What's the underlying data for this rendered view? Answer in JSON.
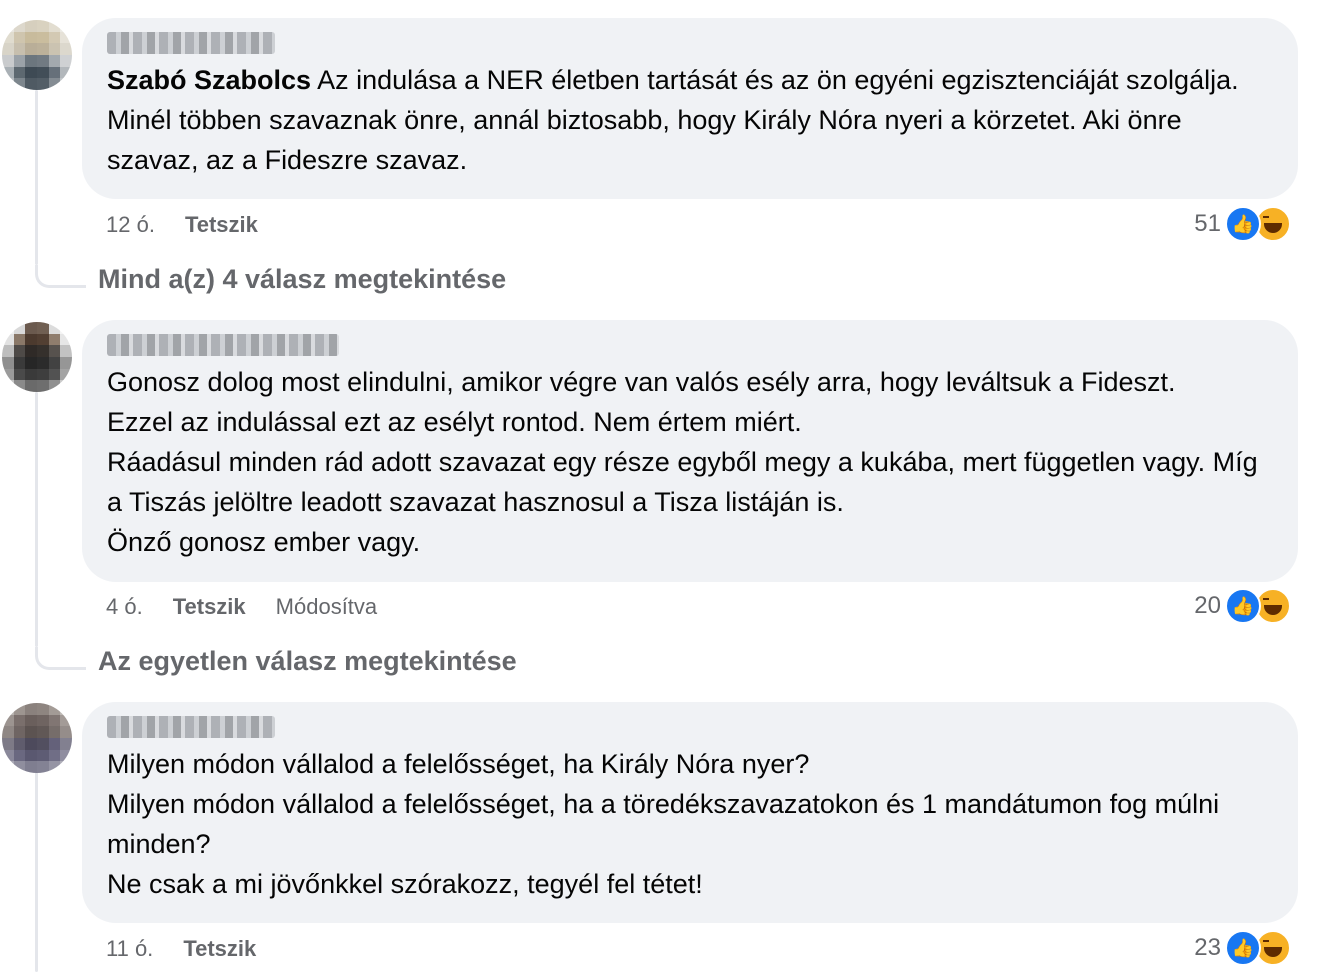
{
  "comments": [
    {
      "mention": "Szabó Szabolcs",
      "text": " Az indulása a NER életben tartását és az ön egyéni egzisztenciáját szolgálja. Minél többen szavaznak önre, annál biztosabb, hogy Király Nóra nyeri a körzetet. Aki önre szavaz, az a Fideszre szavaz.",
      "time": "12 ó.",
      "like_label": "Tetszik",
      "edited": "",
      "reaction_count": "51",
      "replies_link": "Mind a(z) 4 válasz megtekintése"
    },
    {
      "mention": "",
      "text": "Gonosz dolog most elindulni, amikor végre van valós esély arra, hogy leváltsuk a Fideszt.\nEzzel az indulással ezt az esélyt rontod. Nem értem miért.\nRáadásul minden rád adott szavazat egy része egyből megy a kukába, mert független vagy. Míg a Tiszás jelöltre leadott szavazat hasznosul a Tisza listáján is.\nÖnző gonosz ember vagy.",
      "time": "4 ó.",
      "like_label": "Tetszik",
      "edited": "Módosítva",
      "reaction_count": "20",
      "replies_link": "Az egyetlen válasz megtekintése"
    },
    {
      "mention": "",
      "text": "Milyen módon vállalod a felelősséget, ha Király Nóra nyer?\nMilyen módon vállalod a felelősséget, ha a töredékszavazatokon és 1 mandátumon fog múlni minden?\nNe csak a mi jövőnkkel szórakozz, tegyél fel tétet!",
      "time": "11 ó.",
      "like_label": "Tetszik",
      "edited": "",
      "reaction_count": "23",
      "replies_link": ""
    }
  ],
  "icons": {
    "like": "like-icon",
    "haha": "haha-icon"
  },
  "colors": {
    "bubble": "#f0f2f5",
    "meta": "#65676b",
    "like": "#1877f2",
    "haha": "#f7b125"
  }
}
